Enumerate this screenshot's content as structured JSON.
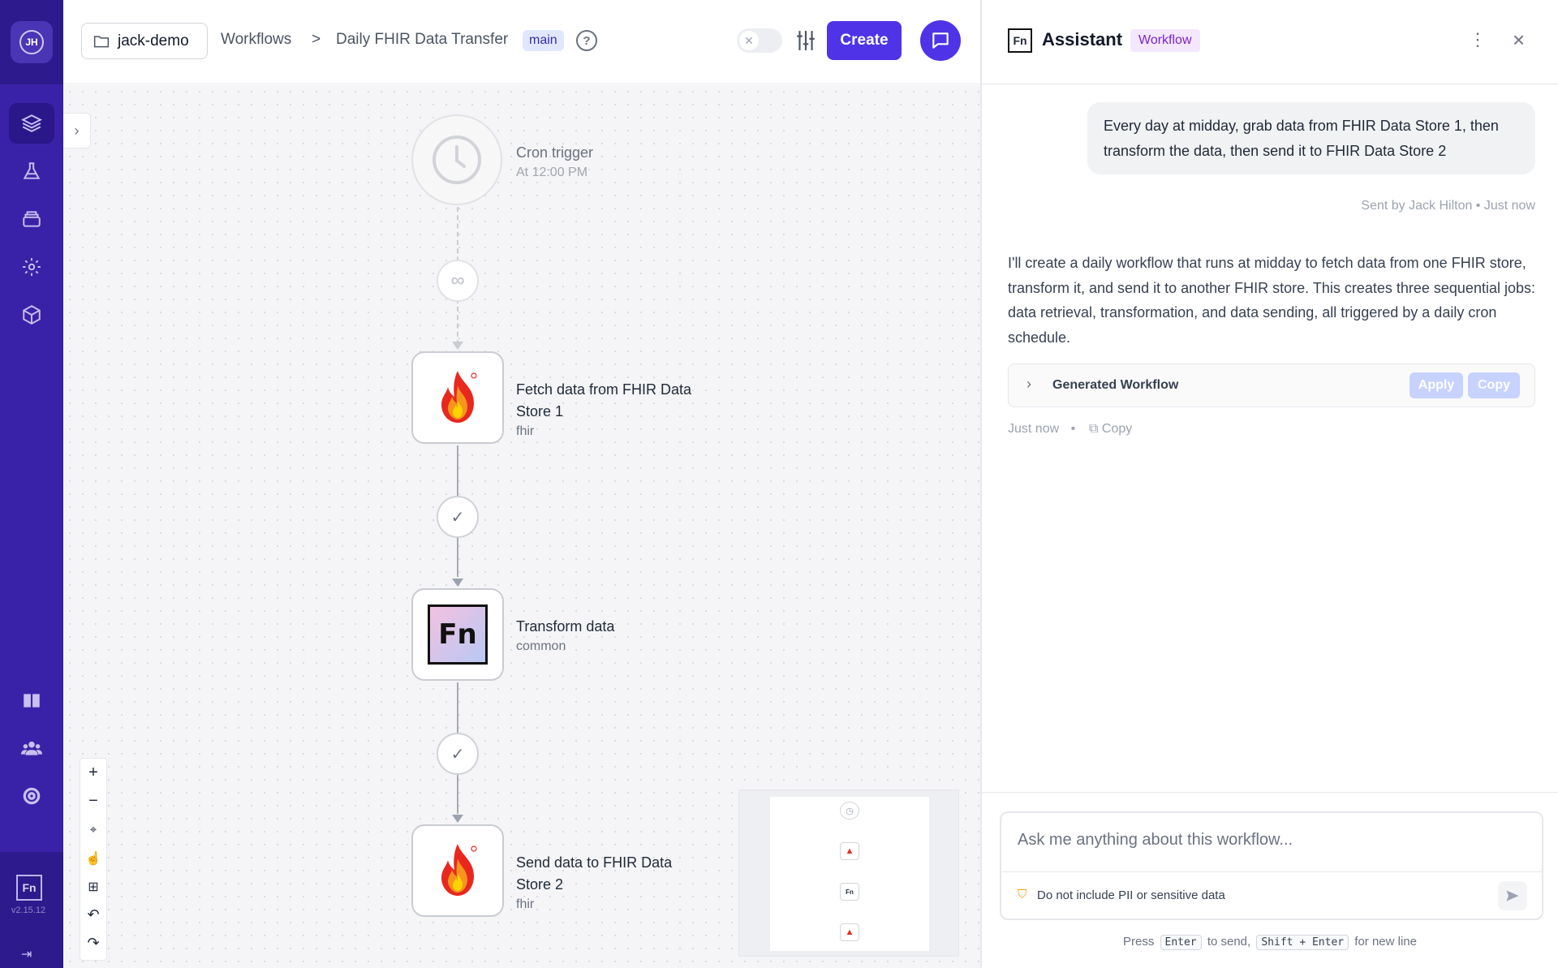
{
  "user": {
    "initials": "JH"
  },
  "app": {
    "version": "v2.15.12",
    "logo_text": "Fn"
  },
  "topbar": {
    "project": "jack-demo",
    "crumb_workflows": "Workflows",
    "crumb_sep": ">",
    "workflow_name": "Daily FHIR Data Transfer",
    "branch": "main",
    "help": "?",
    "toggle_enabled": false,
    "create_label": "Create"
  },
  "nodes": {
    "trigger": {
      "title": "Cron trigger",
      "subtitle": "At 12:00 PM"
    },
    "fetch": {
      "title": "Fetch data from FHIR Data Store 1",
      "adaptor": "fhir"
    },
    "transform": {
      "title": "Transform data",
      "adaptor": "common",
      "icon_text": "Fn"
    },
    "send": {
      "title": "Send data to FHIR Data Store 2",
      "adaptor": "fhir"
    }
  },
  "edges": [
    {
      "condition": "always",
      "icon": "infinity-icon"
    },
    {
      "condition": "on success",
      "icon": "check-icon"
    },
    {
      "condition": "on success",
      "icon": "check-icon"
    }
  ],
  "assistant": {
    "logo_text": "Fn",
    "title": "Assistant",
    "badge": "Workflow",
    "user_message": "Every day at midday, grab data from FHIR Data Store 1, then transform the data, then send it to FHIR Data Store 2",
    "user_meta": "Sent by Jack Hilton • Just now",
    "assistant_message": "I'll create a daily workflow that runs at midday to fetch data from one FHIR store, transform it, and send it to another FHIR store. This creates three sequential jobs: data retrieval, transformation, and data sending, all triggered by a daily cron schedule.",
    "generated_label": "Generated Workflow",
    "apply_label": "Apply",
    "copy_label": "Copy",
    "assistant_time": "Just now",
    "meta_dot": "•",
    "assistant_copy": "Copy",
    "input_placeholder": "Ask me anything about this workflow...",
    "pii_note": "Do not include PII or sensitive data",
    "hint_press": "Press",
    "hint_enter": "Enter",
    "hint_to_send": "to send,",
    "hint_shift_enter": "Shift + Enter",
    "hint_new_line": "for new line"
  },
  "colors": {
    "sidebar": "#3a22a8",
    "accent": "#4f33e6",
    "badge_workflow": "#7e22ce"
  }
}
